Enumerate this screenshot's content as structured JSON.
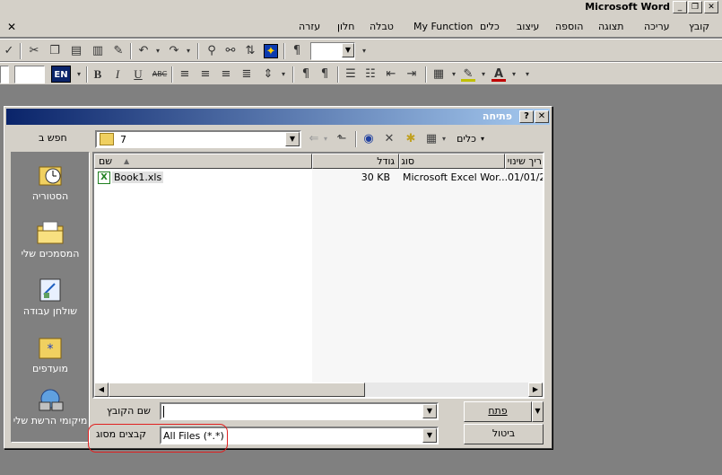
{
  "window": {
    "title": "Microsoft Word",
    "min": "_",
    "restore": "❐",
    "close": "✕"
  },
  "menu": {
    "items": [
      "קובץ",
      "עריכה",
      "תצוגה",
      "הוספה",
      "עיצוב",
      "כלים",
      "My Function",
      "טבלה",
      "חלון",
      "עזרה"
    ],
    "close_doc": "✕"
  },
  "toolbar": {
    "lang_badge": "EN"
  },
  "dialog": {
    "title": "פתיחה",
    "help": "?",
    "close": "✕",
    "look_in_label": "חפש ב",
    "look_in_value": "7",
    "tools_label": "כלים",
    "columns": [
      "שם",
      "גודל",
      "סוג",
      "ריך שינוי"
    ],
    "files": [
      {
        "name": "Book1.xls",
        "size": "30 KB",
        "type": "Microsoft Excel Wor...",
        "modified": "01/01/2"
      }
    ],
    "places": [
      "הסטוריה",
      "המסמכים שלי",
      "שולחן עבודה",
      "מועדפים",
      "מיקומי הרשת שלי"
    ],
    "filename_label": "שם הקובץ",
    "filename_value": "",
    "filetype_label": "קבצים מסוג",
    "filetype_value": "All Files (*.*)",
    "open_button": "פתח",
    "cancel_button": "ביטול"
  }
}
